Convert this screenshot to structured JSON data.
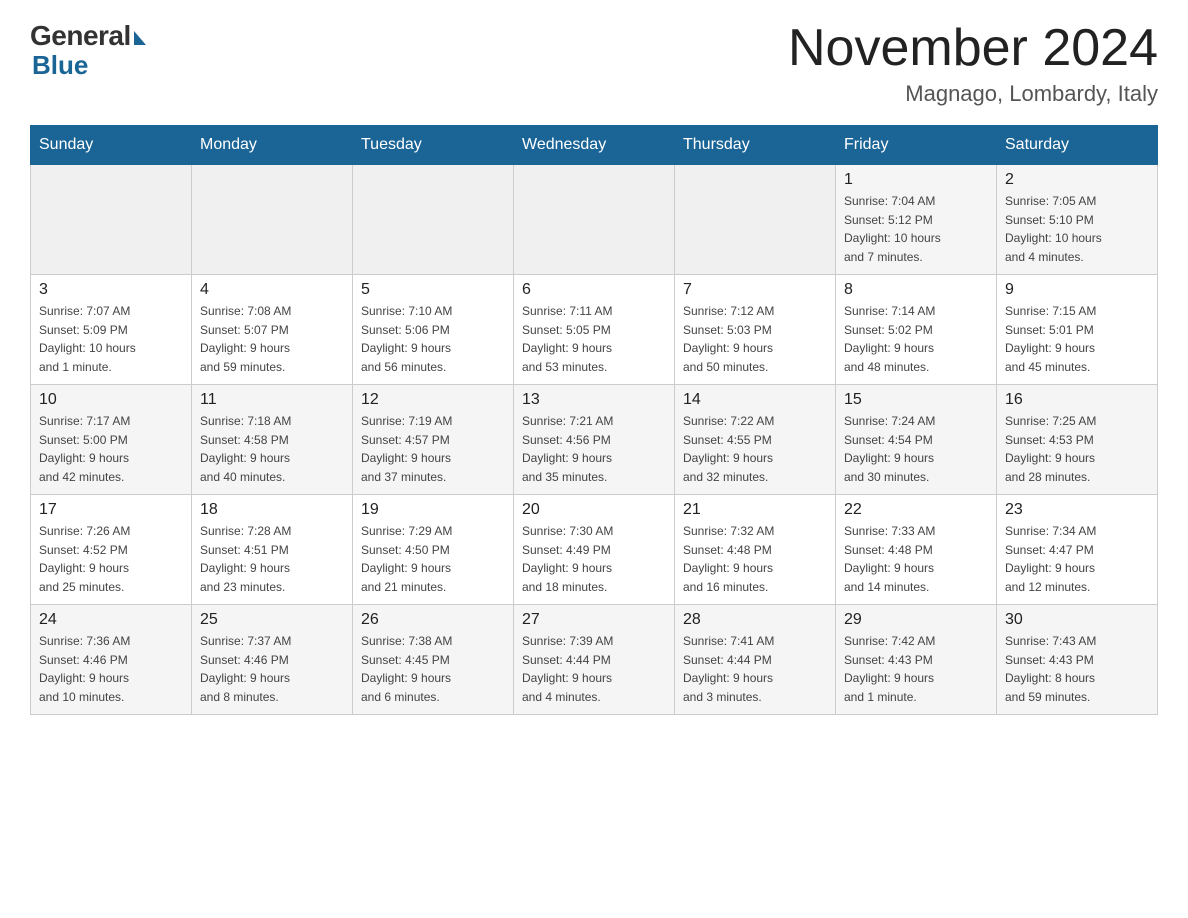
{
  "header": {
    "logo_general": "General",
    "logo_blue": "Blue",
    "title": "November 2024",
    "location": "Magnago, Lombardy, Italy"
  },
  "days_of_week": [
    "Sunday",
    "Monday",
    "Tuesday",
    "Wednesday",
    "Thursday",
    "Friday",
    "Saturday"
  ],
  "weeks": [
    [
      {
        "day": "",
        "info": ""
      },
      {
        "day": "",
        "info": ""
      },
      {
        "day": "",
        "info": ""
      },
      {
        "day": "",
        "info": ""
      },
      {
        "day": "",
        "info": ""
      },
      {
        "day": "1",
        "info": "Sunrise: 7:04 AM\nSunset: 5:12 PM\nDaylight: 10 hours\nand 7 minutes."
      },
      {
        "day": "2",
        "info": "Sunrise: 7:05 AM\nSunset: 5:10 PM\nDaylight: 10 hours\nand 4 minutes."
      }
    ],
    [
      {
        "day": "3",
        "info": "Sunrise: 7:07 AM\nSunset: 5:09 PM\nDaylight: 10 hours\nand 1 minute."
      },
      {
        "day": "4",
        "info": "Sunrise: 7:08 AM\nSunset: 5:07 PM\nDaylight: 9 hours\nand 59 minutes."
      },
      {
        "day": "5",
        "info": "Sunrise: 7:10 AM\nSunset: 5:06 PM\nDaylight: 9 hours\nand 56 minutes."
      },
      {
        "day": "6",
        "info": "Sunrise: 7:11 AM\nSunset: 5:05 PM\nDaylight: 9 hours\nand 53 minutes."
      },
      {
        "day": "7",
        "info": "Sunrise: 7:12 AM\nSunset: 5:03 PM\nDaylight: 9 hours\nand 50 minutes."
      },
      {
        "day": "8",
        "info": "Sunrise: 7:14 AM\nSunset: 5:02 PM\nDaylight: 9 hours\nand 48 minutes."
      },
      {
        "day": "9",
        "info": "Sunrise: 7:15 AM\nSunset: 5:01 PM\nDaylight: 9 hours\nand 45 minutes."
      }
    ],
    [
      {
        "day": "10",
        "info": "Sunrise: 7:17 AM\nSunset: 5:00 PM\nDaylight: 9 hours\nand 42 minutes."
      },
      {
        "day": "11",
        "info": "Sunrise: 7:18 AM\nSunset: 4:58 PM\nDaylight: 9 hours\nand 40 minutes."
      },
      {
        "day": "12",
        "info": "Sunrise: 7:19 AM\nSunset: 4:57 PM\nDaylight: 9 hours\nand 37 minutes."
      },
      {
        "day": "13",
        "info": "Sunrise: 7:21 AM\nSunset: 4:56 PM\nDaylight: 9 hours\nand 35 minutes."
      },
      {
        "day": "14",
        "info": "Sunrise: 7:22 AM\nSunset: 4:55 PM\nDaylight: 9 hours\nand 32 minutes."
      },
      {
        "day": "15",
        "info": "Sunrise: 7:24 AM\nSunset: 4:54 PM\nDaylight: 9 hours\nand 30 minutes."
      },
      {
        "day": "16",
        "info": "Sunrise: 7:25 AM\nSunset: 4:53 PM\nDaylight: 9 hours\nand 28 minutes."
      }
    ],
    [
      {
        "day": "17",
        "info": "Sunrise: 7:26 AM\nSunset: 4:52 PM\nDaylight: 9 hours\nand 25 minutes."
      },
      {
        "day": "18",
        "info": "Sunrise: 7:28 AM\nSunset: 4:51 PM\nDaylight: 9 hours\nand 23 minutes."
      },
      {
        "day": "19",
        "info": "Sunrise: 7:29 AM\nSunset: 4:50 PM\nDaylight: 9 hours\nand 21 minutes."
      },
      {
        "day": "20",
        "info": "Sunrise: 7:30 AM\nSunset: 4:49 PM\nDaylight: 9 hours\nand 18 minutes."
      },
      {
        "day": "21",
        "info": "Sunrise: 7:32 AM\nSunset: 4:48 PM\nDaylight: 9 hours\nand 16 minutes."
      },
      {
        "day": "22",
        "info": "Sunrise: 7:33 AM\nSunset: 4:48 PM\nDaylight: 9 hours\nand 14 minutes."
      },
      {
        "day": "23",
        "info": "Sunrise: 7:34 AM\nSunset: 4:47 PM\nDaylight: 9 hours\nand 12 minutes."
      }
    ],
    [
      {
        "day": "24",
        "info": "Sunrise: 7:36 AM\nSunset: 4:46 PM\nDaylight: 9 hours\nand 10 minutes."
      },
      {
        "day": "25",
        "info": "Sunrise: 7:37 AM\nSunset: 4:46 PM\nDaylight: 9 hours\nand 8 minutes."
      },
      {
        "day": "26",
        "info": "Sunrise: 7:38 AM\nSunset: 4:45 PM\nDaylight: 9 hours\nand 6 minutes."
      },
      {
        "day": "27",
        "info": "Sunrise: 7:39 AM\nSunset: 4:44 PM\nDaylight: 9 hours\nand 4 minutes."
      },
      {
        "day": "28",
        "info": "Sunrise: 7:41 AM\nSunset: 4:44 PM\nDaylight: 9 hours\nand 3 minutes."
      },
      {
        "day": "29",
        "info": "Sunrise: 7:42 AM\nSunset: 4:43 PM\nDaylight: 9 hours\nand 1 minute."
      },
      {
        "day": "30",
        "info": "Sunrise: 7:43 AM\nSunset: 4:43 PM\nDaylight: 8 hours\nand 59 minutes."
      }
    ]
  ]
}
